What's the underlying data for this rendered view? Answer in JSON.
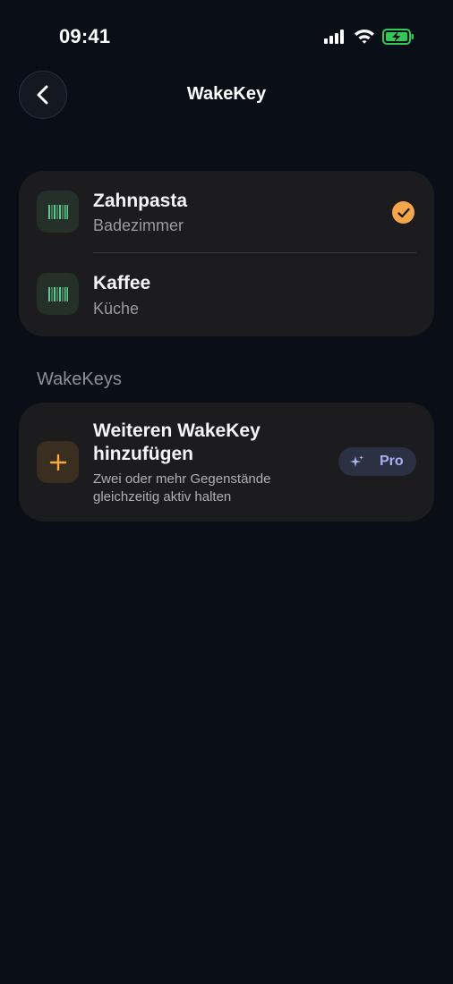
{
  "status_bar": {
    "time": "09:41",
    "icons": [
      "signal-icon",
      "wifi-icon",
      "battery-charging-icon"
    ],
    "battery_color": "#34c759"
  },
  "nav": {
    "back_icon": "chevron-left-icon",
    "title": "WakeKey"
  },
  "items": [
    {
      "title": "Zahnpasta",
      "subtitle": "Badezimmer",
      "icon": "barcode-icon",
      "selected": true
    },
    {
      "title": "Kaffee",
      "subtitle": "Küche",
      "icon": "barcode-icon",
      "selected": false
    }
  ],
  "section": {
    "label": "WakeKeys"
  },
  "add_card": {
    "icon": "plus-icon",
    "title": "Weiteren WakeKey hinzufügen",
    "description": "Zwei oder mehr Gegenstände gleichzeitig aktiv halten",
    "badge_icon": "sparkle-icon",
    "badge_label": "Pro"
  },
  "colors": {
    "background": "#0a0e16",
    "card": "#1c1c1e",
    "accent_orange": "#f5a64a",
    "barcode_green": "#5ec98a",
    "pro_text": "#a7b1f0"
  }
}
